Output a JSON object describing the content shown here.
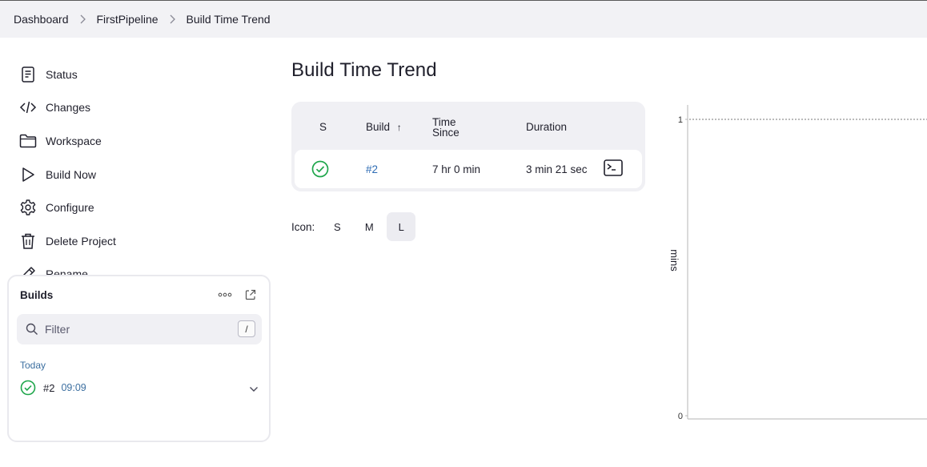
{
  "breadcrumb": {
    "items": [
      {
        "label": "Dashboard"
      },
      {
        "label": "FirstPipeline"
      },
      {
        "label": "Build Time Trend"
      }
    ]
  },
  "sidebar": {
    "tasks": [
      {
        "label": "Status",
        "icon": "document-icon"
      },
      {
        "label": "Changes",
        "icon": "code-icon"
      },
      {
        "label": "Workspace",
        "icon": "folder-icon"
      },
      {
        "label": "Build Now",
        "icon": "play-icon"
      },
      {
        "label": "Configure",
        "icon": "gear-icon"
      },
      {
        "label": "Delete Project",
        "icon": "trash-icon"
      },
      {
        "label": "Rename",
        "icon": "pencil-icon"
      }
    ],
    "builds": {
      "title": "Builds",
      "filter_placeholder": "Filter",
      "filter_shortcut": "/",
      "group_label": "Today",
      "items": [
        {
          "number": "#2",
          "time": "09:09",
          "status": "success"
        }
      ]
    }
  },
  "main": {
    "title": "Build Time Trend",
    "table": {
      "headers": {
        "status": "S",
        "build": "Build",
        "sort_indicator": "↑",
        "time_since_1": "Time",
        "time_since_2": "Since",
        "duration": "Duration"
      },
      "rows": [
        {
          "status": "success",
          "build": "#2",
          "time_since": "7 hr 0 min",
          "duration": "3 min 21 sec"
        }
      ]
    },
    "icon_size": {
      "label": "Icon:",
      "options": [
        "S",
        "M",
        "L"
      ],
      "selected": "L"
    }
  },
  "chart_data": {
    "type": "area",
    "ylabel": "mins",
    "yticks": [
      "1",
      "0"
    ],
    "ylim": [
      0,
      1
    ],
    "reference_line_y": 1,
    "series": []
  },
  "colors": {
    "success": "#1ea64b",
    "link": "#2e6cb4",
    "panel": "#f0f0f4"
  }
}
